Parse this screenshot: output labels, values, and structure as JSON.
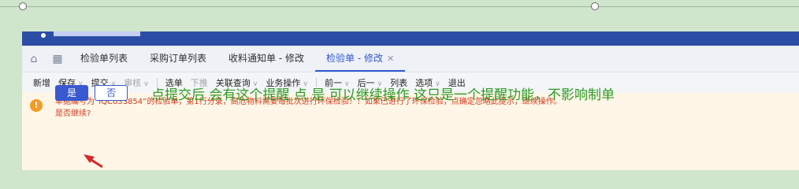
{
  "tabs": [
    {
      "label": "检验单列表"
    },
    {
      "label": "采购订单列表"
    },
    {
      "label": "收料通知单 - 修改"
    },
    {
      "label": "检验单 - 修改",
      "active": true
    }
  ],
  "toolbar": {
    "new": "新增",
    "save": "保存",
    "submit": "提交",
    "audit": "审核",
    "select": "选单",
    "push": "下推",
    "linked_query": "关联查询",
    "business_ops": "业务操作",
    "prev": "前一",
    "next": "后一",
    "list": "列表",
    "options": "选项",
    "exit": "退出"
  },
  "alert": {
    "message": "单据编号为“IQC033854”的检验单，第1行分录，高危物料需要每批次进行环保检验！！如果已进行了环保检验，点确定忽略此提示，继续操作。",
    "question": "是否继续?"
  },
  "buttons": {
    "yes": "是",
    "no": "否"
  },
  "annotation": "点提交后  会有这个提醒     点  是  可以继续操作  这只是一个提醒功能，不影响制单",
  "icons": {
    "home": "home-icon",
    "grid": "grid-icon",
    "warning": "warning-icon",
    "close": "close-icon"
  },
  "colors": {
    "accent": "#2f58d0",
    "warning": "#f59a23",
    "alert_text": "#d33b1c",
    "annotation": "#2c9a24",
    "arrow": "#d8262a"
  }
}
